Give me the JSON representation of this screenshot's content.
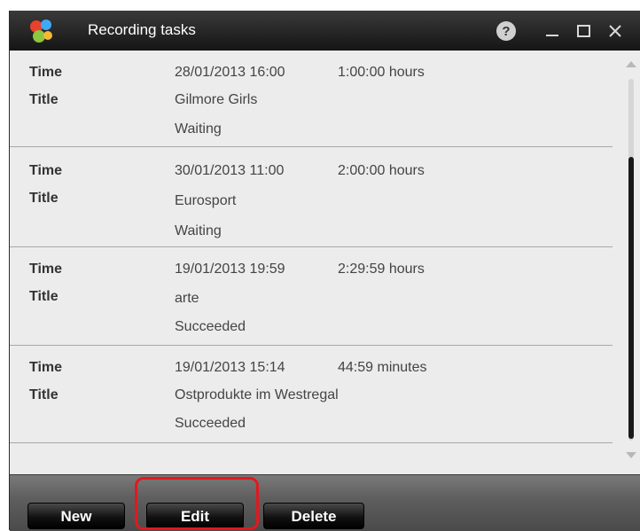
{
  "window": {
    "title": "Recording tasks"
  },
  "tasks": [
    {
      "time_label": "Time",
      "title_label": "Title",
      "time": "28/01/2013 16:00",
      "duration": "1:00:00 hours",
      "title": "Gilmore Girls",
      "status": "Waiting"
    },
    {
      "time_label": "Time",
      "title_label": "Title",
      "time": "30/01/2013 11:00",
      "duration": "2:00:00 hours",
      "title": "Eurosport",
      "status": "Waiting"
    },
    {
      "time_label": "Time",
      "title_label": "Title",
      "time": "19/01/2013 19:59",
      "duration": "2:29:59 hours",
      "title": "arte",
      "status": "Succeeded"
    },
    {
      "time_label": "Time",
      "title_label": "Title",
      "time": "19/01/2013 15:14",
      "duration": "44:59 minutes",
      "title": "Ostprodukte im Westregal",
      "status": "Succeeded"
    }
  ],
  "buttons": {
    "new": "New",
    "edit": "Edit",
    "delete": "Delete"
  },
  "icons": {
    "logo": "app-logo-icon",
    "help": "help-icon",
    "minimize": "minimize-icon",
    "maximize": "maximize-icon",
    "close": "close-icon"
  },
  "colors": {
    "highlight": "#e0191e",
    "titlebar": "#1e1e1e",
    "list_background": "#ececec"
  }
}
